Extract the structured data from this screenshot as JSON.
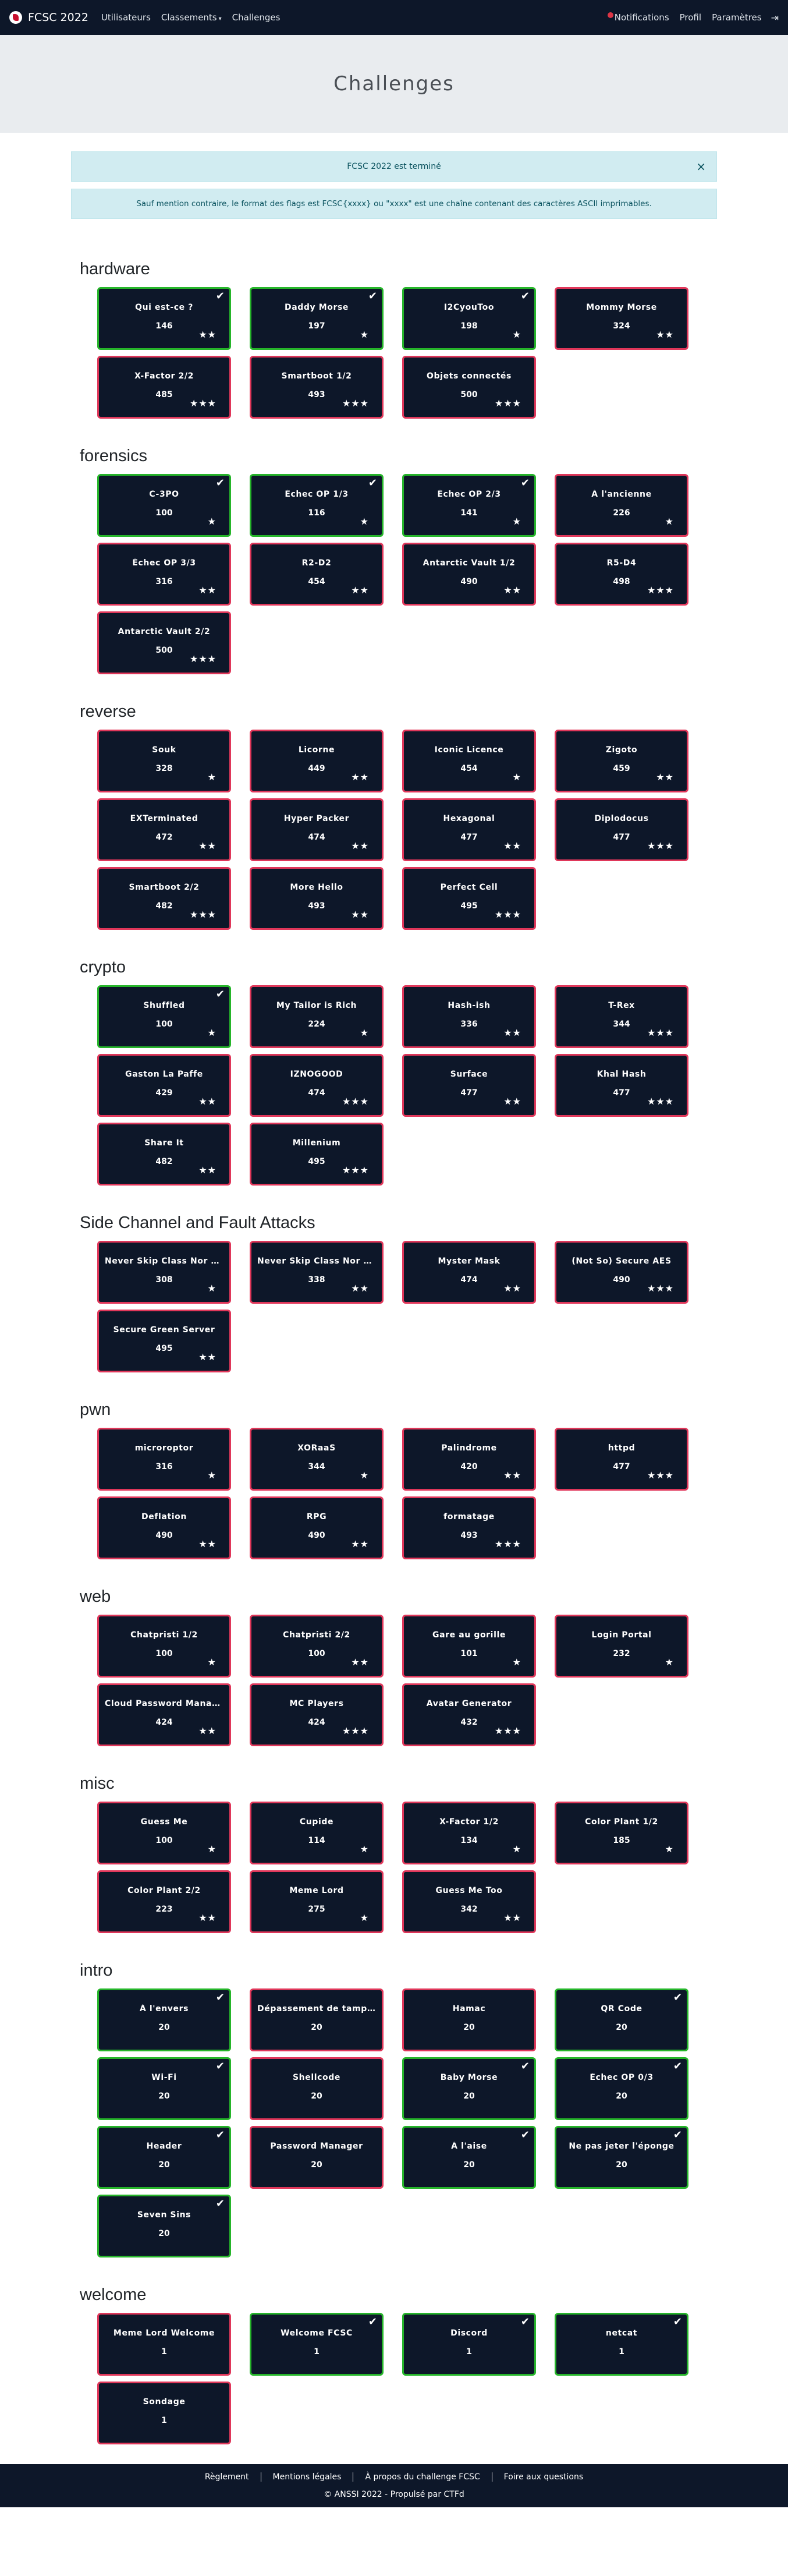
{
  "nav": {
    "brand": "FCSC 2022",
    "links": [
      "Utilisateurs",
      "Classements",
      "Challenges"
    ],
    "right_links": [
      "Notifications",
      "Profil",
      "Paramètres"
    ]
  },
  "page_title": "Challenges",
  "alerts": {
    "ended": "FCSC 2022 est terminé",
    "close": "×",
    "flag_format": "Sauf mention contraire, le format des flags est FCSC{xxxx} ou \"xxxx\" est une chaîne contenant des caractères ASCII imprimables."
  },
  "categories": [
    {
      "name": "hardware",
      "challenges": [
        {
          "name": "Qui est-ce ?",
          "points": "146",
          "stars": 2,
          "solved": true
        },
        {
          "name": "Daddy Morse",
          "points": "197",
          "stars": 1,
          "solved": true
        },
        {
          "name": "I2CyouToo",
          "points": "198",
          "stars": 1,
          "solved": true
        },
        {
          "name": "Mommy Morse",
          "points": "324",
          "stars": 2,
          "solved": false
        },
        {
          "name": "X-Factor 2/2",
          "points": "485",
          "stars": 3,
          "solved": false
        },
        {
          "name": "Smartboot 1/2",
          "points": "493",
          "stars": 3,
          "solved": false
        },
        {
          "name": "Objets connectés",
          "points": "500",
          "stars": 3,
          "solved": false
        }
      ]
    },
    {
      "name": "forensics",
      "challenges": [
        {
          "name": "C-3PO",
          "points": "100",
          "stars": 1,
          "solved": true
        },
        {
          "name": "Échec OP 1/3",
          "points": "116",
          "stars": 1,
          "solved": true
        },
        {
          "name": "Échec OP 2/3",
          "points": "141",
          "stars": 1,
          "solved": true
        },
        {
          "name": "À l'ancienne",
          "points": "226",
          "stars": 1,
          "solved": false
        },
        {
          "name": "Échec OP 3/3",
          "points": "316",
          "stars": 2,
          "solved": false
        },
        {
          "name": "R2-D2",
          "points": "454",
          "stars": 2,
          "solved": false
        },
        {
          "name": "Antarctic Vault 1/2",
          "points": "490",
          "stars": 2,
          "solved": false
        },
        {
          "name": "R5-D4",
          "points": "498",
          "stars": 3,
          "solved": false
        },
        {
          "name": "Antarctic Vault 2/2",
          "points": "500",
          "stars": 3,
          "solved": false
        }
      ]
    },
    {
      "name": "reverse",
      "challenges": [
        {
          "name": "Souk",
          "points": "328",
          "stars": 1,
          "solved": false
        },
        {
          "name": "Licorne",
          "points": "449",
          "stars": 2,
          "solved": false
        },
        {
          "name": "Iconic Licence",
          "points": "454",
          "stars": 1,
          "solved": false
        },
        {
          "name": "Zigoto",
          "points": "459",
          "stars": 2,
          "solved": false
        },
        {
          "name": "EXTerminated",
          "points": "472",
          "stars": 2,
          "solved": false
        },
        {
          "name": "Hyper Packer",
          "points": "474",
          "stars": 2,
          "solved": false
        },
        {
          "name": "Hexagonal",
          "points": "477",
          "stars": 2,
          "solved": false
        },
        {
          "name": "Diplodocus",
          "points": "477",
          "stars": 3,
          "solved": false
        },
        {
          "name": "Smartboot 2/2",
          "points": "482",
          "stars": 3,
          "solved": false
        },
        {
          "name": "More Hello",
          "points": "493",
          "stars": 2,
          "solved": false
        },
        {
          "name": "Perfect Cell",
          "points": "495",
          "stars": 3,
          "solved": false
        }
      ]
    },
    {
      "name": "crypto",
      "challenges": [
        {
          "name": "Shuffled",
          "points": "100",
          "stars": 1,
          "solved": true
        },
        {
          "name": "My Tailor is Rich",
          "points": "224",
          "stars": 1,
          "solved": false
        },
        {
          "name": "Hash-ish",
          "points": "336",
          "stars": 2,
          "solved": false
        },
        {
          "name": "T-Rex",
          "points": "344",
          "stars": 3,
          "solved": false
        },
        {
          "name": "Gaston La Paffe",
          "points": "429",
          "stars": 2,
          "solved": false
        },
        {
          "name": "IZNOGOOD",
          "points": "474",
          "stars": 3,
          "solved": false
        },
        {
          "name": "Surface",
          "points": "477",
          "stars": 2,
          "solved": false
        },
        {
          "name": "Khal Hash",
          "points": "477",
          "stars": 3,
          "solved": false
        },
        {
          "name": "Share It",
          "points": "482",
          "stars": 2,
          "solved": false
        },
        {
          "name": "Millenium",
          "points": "495",
          "stars": 3,
          "solved": false
        }
      ]
    },
    {
      "name": "Side Channel and Fault Attacks",
      "challenges": [
        {
          "name": "Never Skip Class Nor M...",
          "points": "308",
          "stars": 1,
          "solved": false
        },
        {
          "name": "Never Skip Class Nor Sq...",
          "points": "338",
          "stars": 2,
          "solved": false
        },
        {
          "name": "Myster Mask",
          "points": "474",
          "stars": 2,
          "solved": false
        },
        {
          "name": "(Not So) Secure AES",
          "points": "490",
          "stars": 3,
          "solved": false
        },
        {
          "name": "Secure Green Server",
          "points": "495",
          "stars": 2,
          "solved": false
        }
      ]
    },
    {
      "name": "pwn",
      "challenges": [
        {
          "name": "microroptor",
          "points": "316",
          "stars": 1,
          "solved": false
        },
        {
          "name": "XORaaS",
          "points": "344",
          "stars": 1,
          "solved": false
        },
        {
          "name": "Palindrome",
          "points": "420",
          "stars": 2,
          "solved": false
        },
        {
          "name": "httpd",
          "points": "477",
          "stars": 3,
          "solved": false
        },
        {
          "name": "Deflation",
          "points": "490",
          "stars": 2,
          "solved": false
        },
        {
          "name": "RPG",
          "points": "490",
          "stars": 2,
          "solved": false
        },
        {
          "name": "formatage",
          "points": "493",
          "stars": 3,
          "solved": false
        }
      ]
    },
    {
      "name": "web",
      "challenges": [
        {
          "name": "Chatpristi 1/2",
          "points": "100",
          "stars": 1,
          "solved": false
        },
        {
          "name": "Chatpristi 2/2",
          "points": "100",
          "stars": 2,
          "solved": false
        },
        {
          "name": "Gare au gorille",
          "points": "101",
          "stars": 1,
          "solved": false
        },
        {
          "name": "Login Portal",
          "points": "232",
          "stars": 1,
          "solved": false
        },
        {
          "name": "Cloud Password Manager",
          "points": "424",
          "stars": 2,
          "solved": false
        },
        {
          "name": "MC Players",
          "points": "424",
          "stars": 3,
          "solved": false
        },
        {
          "name": "Avatar Generator",
          "points": "432",
          "stars": 3,
          "solved": false
        }
      ]
    },
    {
      "name": "misc",
      "challenges": [
        {
          "name": "Guess Me",
          "points": "100",
          "stars": 1,
          "solved": false
        },
        {
          "name": "Cupide",
          "points": "114",
          "stars": 1,
          "solved": false
        },
        {
          "name": "X-Factor 1/2",
          "points": "134",
          "stars": 1,
          "solved": false
        },
        {
          "name": "Color Plant 1/2",
          "points": "185",
          "stars": 1,
          "solved": false
        },
        {
          "name": "Color Plant 2/2",
          "points": "223",
          "stars": 2,
          "solved": false
        },
        {
          "name": "Meme Lord",
          "points": "275",
          "stars": 1,
          "solved": false
        },
        {
          "name": "Guess Me Too",
          "points": "342",
          "stars": 2,
          "solved": false
        }
      ]
    },
    {
      "name": "intro",
      "challenges": [
        {
          "name": "À l'envers",
          "points": "20",
          "stars": 0,
          "solved": true
        },
        {
          "name": "Dépassement de tampon",
          "points": "20",
          "stars": 0,
          "solved": false
        },
        {
          "name": "Hamac",
          "points": "20",
          "stars": 0,
          "solved": false
        },
        {
          "name": "QR Code",
          "points": "20",
          "stars": 0,
          "solved": true
        },
        {
          "name": "Wi-Fi",
          "points": "20",
          "stars": 0,
          "solved": true
        },
        {
          "name": "Shellcode",
          "points": "20",
          "stars": 0,
          "solved": false
        },
        {
          "name": "Baby Morse",
          "points": "20",
          "stars": 0,
          "solved": true
        },
        {
          "name": "Échec OP 0/3",
          "points": "20",
          "stars": 0,
          "solved": true
        },
        {
          "name": "Header",
          "points": "20",
          "stars": 0,
          "solved": true
        },
        {
          "name": "Password Manager",
          "points": "20",
          "stars": 0,
          "solved": false
        },
        {
          "name": "À l'aise",
          "points": "20",
          "stars": 0,
          "solved": true
        },
        {
          "name": "Ne pas jeter l'éponge",
          "points": "20",
          "stars": 0,
          "solved": true
        },
        {
          "name": "Seven Sins",
          "points": "20",
          "stars": 0,
          "solved": true
        }
      ]
    },
    {
      "name": "welcome",
      "challenges": [
        {
          "name": "Meme Lord Welcome",
          "points": "1",
          "stars": 0,
          "solved": false
        },
        {
          "name": "Welcome FCSC",
          "points": "1",
          "stars": 0,
          "solved": true
        },
        {
          "name": "Discord",
          "points": "1",
          "stars": 0,
          "solved": true
        },
        {
          "name": "netcat",
          "points": "1",
          "stars": 0,
          "solved": true
        },
        {
          "name": "Sondage",
          "points": "1",
          "stars": 0,
          "solved": false
        }
      ]
    }
  ],
  "footer": {
    "links": [
      "Règlement",
      "Mentions légales",
      "À propos du challenge FCSC",
      "Foire aux questions"
    ],
    "copyright": "© ANSSI 2022 - Propulsé par CTFd"
  },
  "colors": {
    "solved_border": "#26b52a",
    "unsolved_border": "#e0375a",
    "card_bg": "#0d1729"
  },
  "icons": {
    "star": "star-icon",
    "check": "check-icon",
    "logout": "logout-icon"
  }
}
